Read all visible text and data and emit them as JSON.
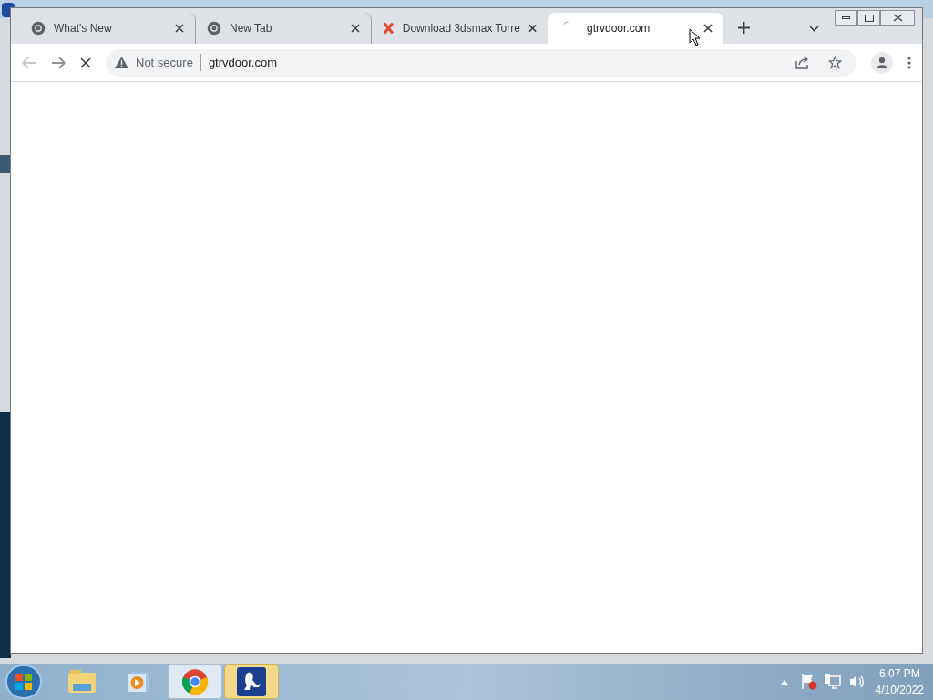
{
  "browser": {
    "tabs": [
      {
        "title": "What's New",
        "kind": "chrome",
        "selected": false
      },
      {
        "title": "New Tab",
        "kind": "chrome",
        "selected": false
      },
      {
        "title": "Download 3dsmax Torre",
        "kind": "x",
        "selected": false
      },
      {
        "title": "gtrvdoor.com",
        "kind": "loading",
        "selected": true
      }
    ],
    "address": {
      "security": "Not secure",
      "url": "gtrvdoor.com",
      "loading": true
    }
  },
  "taskbar": {
    "apps": [
      {
        "kind": "explorer",
        "active": false
      },
      {
        "kind": "media",
        "active": false
      },
      {
        "kind": "chrome",
        "active": true
      },
      {
        "kind": "frog",
        "active": true
      }
    ],
    "clock": {
      "time": "6:07 PM",
      "date": "4/10/2022"
    }
  }
}
